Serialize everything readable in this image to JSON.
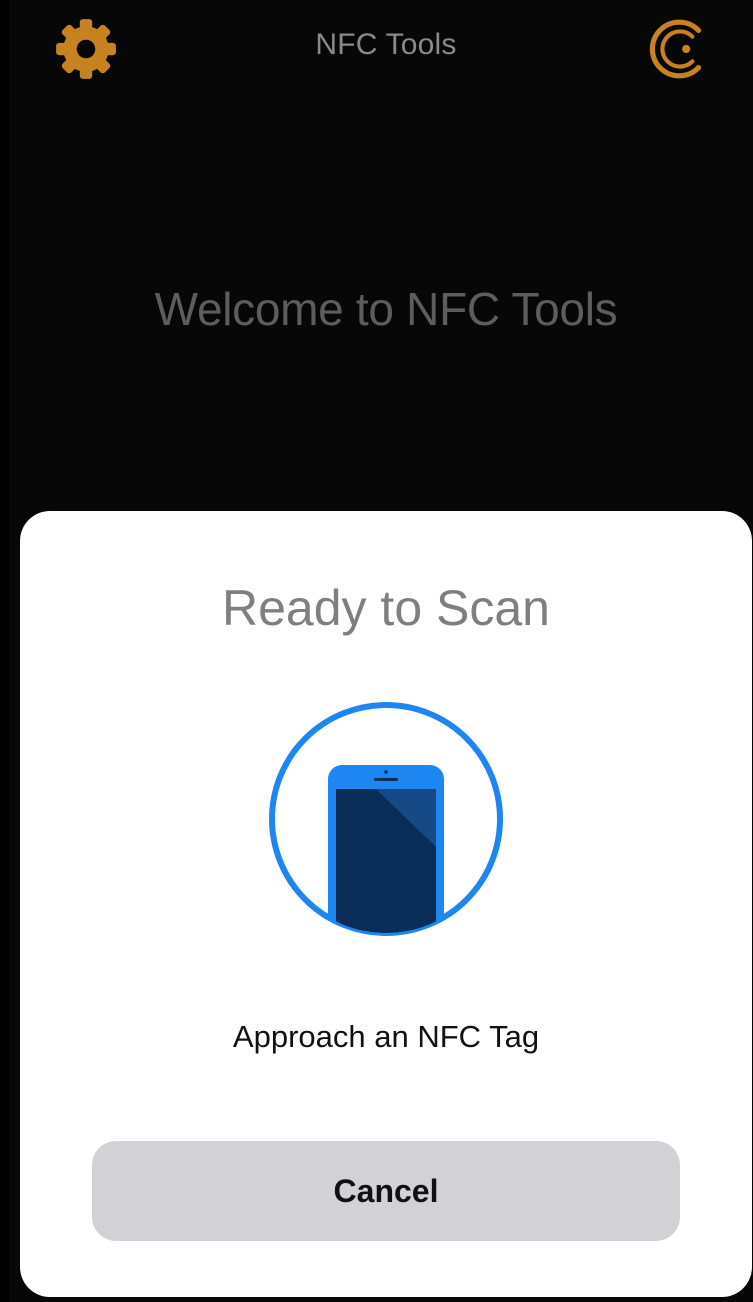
{
  "app": {
    "title": "NFC Tools",
    "accent_color": "#c7831f"
  },
  "nav": {
    "left_icon": "gear-icon",
    "right_icon": "brand-c-logo-icon"
  },
  "main": {
    "welcome_text": "Welcome to NFC Tools"
  },
  "scan_sheet": {
    "title": "Ready to Scan",
    "illustration_icon": "phone-scan-icon",
    "illustration_color": "#1e86f0",
    "message": "Approach an NFC Tag",
    "cancel_label": "Cancel"
  }
}
